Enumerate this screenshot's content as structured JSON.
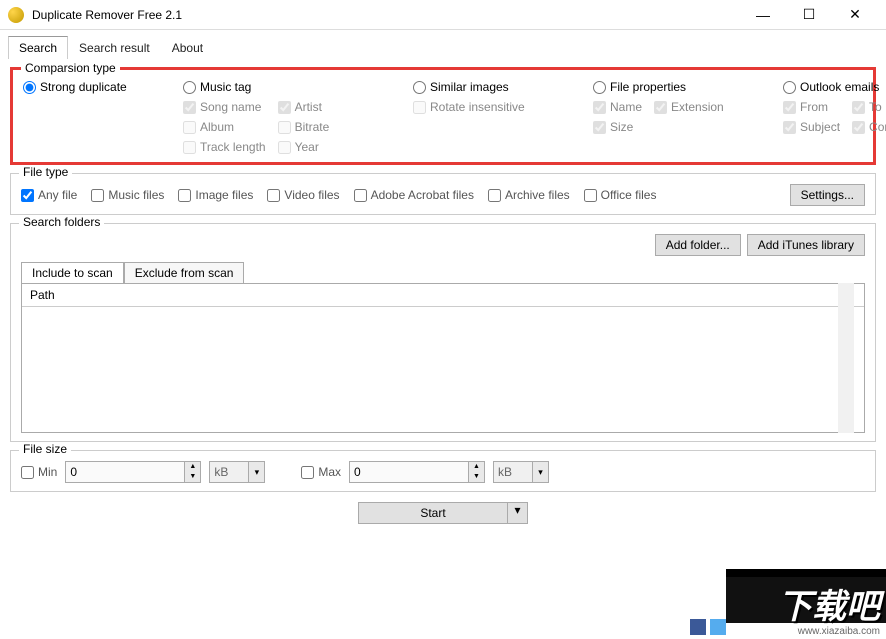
{
  "window": {
    "title": "Duplicate Remover Free 2.1"
  },
  "tabs": {
    "search": "Search",
    "result": "Search result",
    "about": "About"
  },
  "comp": {
    "legend": "Comparsion type",
    "strong": "Strong duplicate",
    "music": {
      "label": "Music tag",
      "song": "Song name",
      "artist": "Artist",
      "album": "Album",
      "bitrate": "Bitrate",
      "tracklen": "Track length",
      "year": "Year"
    },
    "similar": {
      "label": "Similar images",
      "rotate": "Rotate insensitive"
    },
    "fileprops": {
      "label": "File properties",
      "name": "Name",
      "ext": "Extension",
      "size": "Size"
    },
    "outlook": {
      "label": "Outlook emails",
      "from": "From",
      "to": "To",
      "subject": "Subject",
      "content": "Content"
    }
  },
  "filetype": {
    "legend": "File type",
    "any": "Any file",
    "music": "Music files",
    "image": "Image files",
    "video": "Video files",
    "adobe": "Adobe Acrobat files",
    "archive": "Archive files",
    "office": "Office files",
    "settings": "Settings..."
  },
  "sf": {
    "legend": "Search folders",
    "addfolder": "Add folder...",
    "additunes": "Add iTunes library",
    "include": "Include to scan",
    "exclude": "Exclude from scan",
    "path": "Path"
  },
  "fs": {
    "legend": "File size",
    "min": "Min",
    "max": "Max",
    "minval": "0",
    "maxval": "0",
    "unit": "kB"
  },
  "start": "Start",
  "watermark": {
    "text": "下载吧",
    "url": "www.xiazaiba.com"
  }
}
